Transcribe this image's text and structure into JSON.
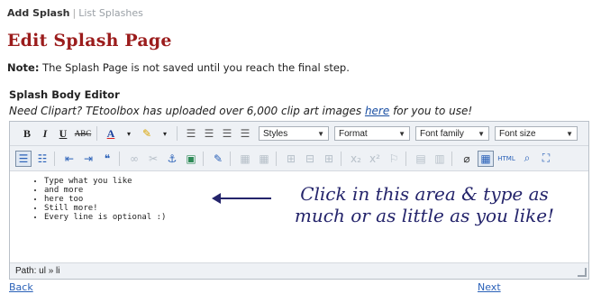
{
  "top_links": {
    "add": "Add Splash",
    "separator": "|",
    "list": "List Splashes"
  },
  "page": {
    "title": "Edit Splash Page"
  },
  "note": {
    "label": "Note:",
    "text": "The Splash Page is not saved until you reach the final step."
  },
  "editor_section": {
    "heading": "Splash Body Editor",
    "clipart_prefix": "Need Clipart? TEtoolbox has uploaded over 6,000 clip art images",
    "clipart_link": "here",
    "clipart_suffix": "for you to use!"
  },
  "toolbar": {
    "bold": "B",
    "italic": "I",
    "underline": "U",
    "strike": "ABC",
    "font_color": "A",
    "styles": "Styles",
    "format": "Format",
    "font_family": "Font family",
    "font_size": "Font size"
  },
  "content": {
    "items": [
      "Type what you like",
      "and more",
      "here too",
      "Still more!",
      "Every line is optional :)"
    ],
    "callout": "Click in this area & type as much or as little as you like!"
  },
  "statusbar": {
    "path": "Path: ul » li"
  },
  "nav": {
    "back": "Back",
    "next": "Next"
  },
  "colors": {
    "title": "#9b1c1c",
    "link": "#2a61b8",
    "callout": "#24246b",
    "toolbar_bg": "#eef1f5"
  },
  "icons": [
    "bullet-list-icon",
    "numbered-list-icon",
    "outdent-icon",
    "indent-icon",
    "blockquote-icon",
    "link-icon",
    "unlink-icon",
    "anchor-icon",
    "image-icon",
    "edit-icon",
    "table-icon",
    "html-icon",
    "preview-icon",
    "fullscreen-icon",
    "help-icon"
  ]
}
